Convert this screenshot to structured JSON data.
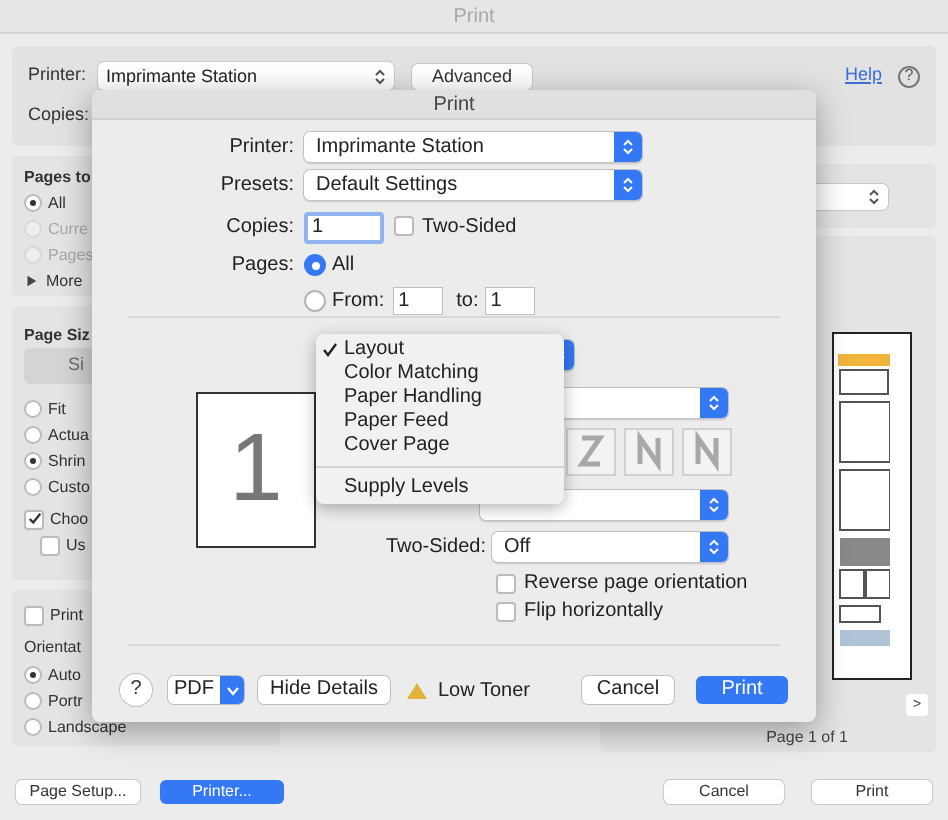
{
  "background_window": {
    "title": "Print",
    "printer_label": "Printer:",
    "printer": "Imprimante Station",
    "advanced_button": "Advanced",
    "help_link": "Help",
    "help_icon_label": "?",
    "copies_label": "Copies:",
    "pages_section": {
      "title": "Pages to",
      "options": [
        {
          "label": "All",
          "selected": true,
          "disabled": false
        },
        {
          "label": "Curre",
          "selected": false,
          "disabled": true
        },
        {
          "label": "Pages",
          "selected": false,
          "disabled": true
        }
      ],
      "more": {
        "label": "More",
        "expanded": false
      }
    },
    "page_size_section": {
      "title": "Page Siz",
      "button": "Si",
      "options": [
        {
          "label": "Fit",
          "selected": false
        },
        {
          "label": "Actua",
          "selected": false
        },
        {
          "label": "Shrin",
          "selected": true
        },
        {
          "label": "Custo",
          "selected": false
        }
      ],
      "checkboxes": [
        {
          "label": "Choo",
          "checked": true
        },
        {
          "label": "Us",
          "checked": false
        }
      ]
    },
    "print_checkbox": {
      "label": "Print",
      "checked": false
    },
    "orientation": {
      "title": "Orientat",
      "options": [
        {
          "label": "Auto",
          "selected": true
        },
        {
          "label": "Portr",
          "selected": false
        },
        {
          "label": "Landscape",
          "selected": false
        }
      ]
    },
    "preview": {
      "next_button": ">",
      "page_label": "Page 1 of 1"
    },
    "left_buttons": [
      {
        "label": "Page Setup...",
        "primary": false
      },
      {
        "label": "Printer...",
        "primary": true
      }
    ],
    "right_buttons": [
      {
        "label": "Cancel",
        "primary": false
      },
      {
        "label": "Print",
        "primary": false
      }
    ]
  },
  "sheet": {
    "title": "Print",
    "printer_label": "Printer:",
    "printer": "Imprimante Station",
    "presets_label": "Presets:",
    "preset": "Default Settings",
    "copies_label": "Copies:",
    "copies": "1",
    "two_sided": {
      "label": "Two-Sided",
      "checked": false
    },
    "pages_label": "Pages:",
    "page_options": [
      {
        "label": "All",
        "selected": true
      },
      {
        "label": "From:",
        "selected": false
      }
    ],
    "from": "1",
    "to_label": "to:",
    "to": "1",
    "thumbnail": "1",
    "menu": {
      "items": [
        {
          "label": "Layout",
          "checked": true
        },
        {
          "label": "Color Matching",
          "checked": false
        },
        {
          "label": "Paper Handling",
          "checked": false
        },
        {
          "label": "Paper Feed",
          "checked": false
        },
        {
          "label": "Cover Page",
          "checked": false
        }
      ],
      "extra_items": [
        {
          "label": "Supply Levels",
          "checked": false
        }
      ]
    },
    "two_sided_label": "Two-Sided:",
    "two_sided_value": "Off",
    "layout_checkboxes": [
      {
        "label": "Reverse page orientation",
        "checked": false
      },
      {
        "label": "Flip horizontally",
        "checked": false
      }
    ],
    "help_button": "?",
    "pdf_button": "PDF",
    "hide_details_button": "Hide Details",
    "status": "Low Toner",
    "buttons": [
      {
        "label": "Cancel",
        "primary": false
      },
      {
        "label": "Print",
        "primary": true
      }
    ]
  }
}
